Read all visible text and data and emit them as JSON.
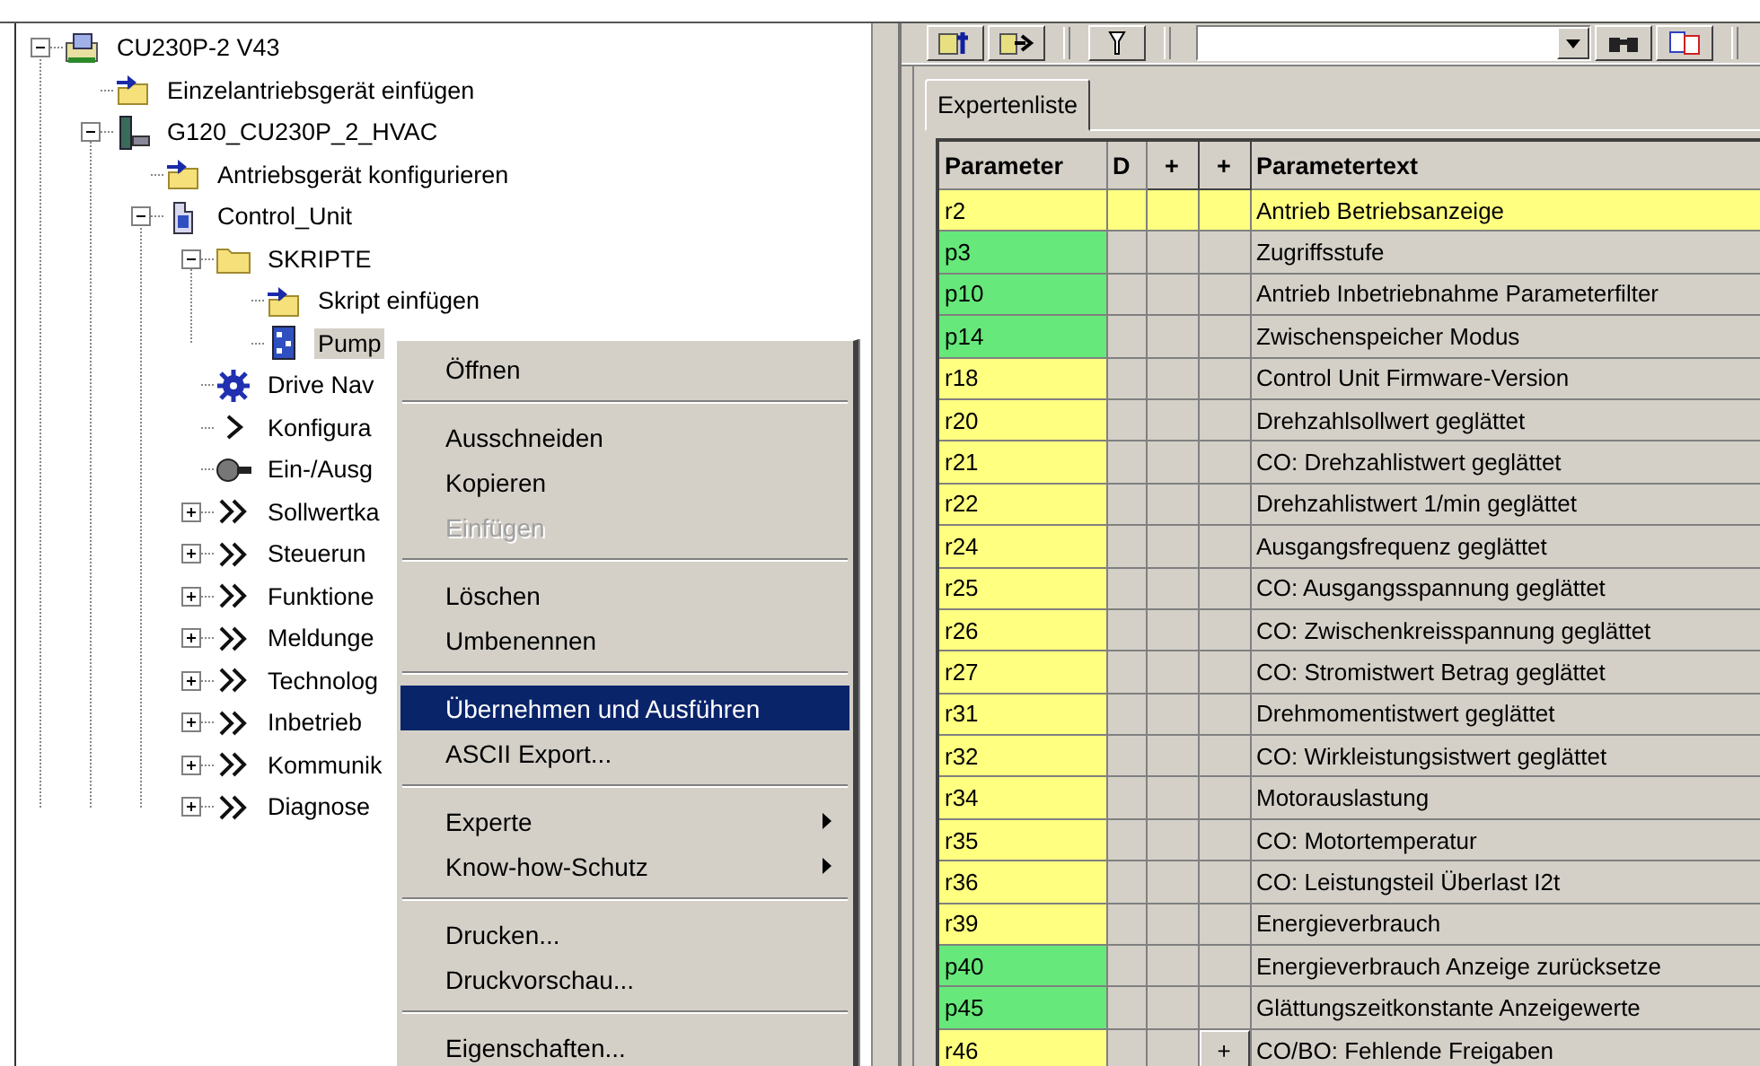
{
  "tree": [
    {
      "label": "CU230P-2 V43",
      "kind": "project",
      "expanded": true,
      "selected": false,
      "children": [
        {
          "label": "Einzelantriebsgerät einfügen",
          "kind": "insert",
          "selected": false
        },
        {
          "label": "G120_CU230P_2_HVAC",
          "kind": "device",
          "expanded": true,
          "selected": false,
          "children": [
            {
              "label": "Antriebsgerät konfigurieren",
              "kind": "insert",
              "selected": false
            },
            {
              "label": "Control_Unit",
              "kind": "unit",
              "expanded": true,
              "selected": false,
              "children": [
                {
                  "label": "SKRIPTE",
                  "kind": "folder",
                  "expanded": true,
                  "selected": false,
                  "children": [
                    {
                      "label": "Skript einfügen",
                      "kind": "insert",
                      "selected": false
                    },
                    {
                      "label": "Pump",
                      "kind": "script",
                      "selected": true
                    }
                  ]
                },
                {
                  "label": "Drive Nav",
                  "kind": "navigator",
                  "selected": false
                },
                {
                  "label": "Konfigura",
                  "kind": "wizard",
                  "selected": false
                },
                {
                  "label": "Ein-/Ausg",
                  "kind": "io",
                  "selected": false
                },
                {
                  "label": "Sollwertka",
                  "kind": "group",
                  "expanded": false,
                  "selected": false
                },
                {
                  "label": "Steuerun",
                  "kind": "group",
                  "expanded": false,
                  "selected": false
                },
                {
                  "label": "Funktione",
                  "kind": "group",
                  "expanded": false,
                  "selected": false
                },
                {
                  "label": "Meldunge",
                  "kind": "group",
                  "expanded": false,
                  "selected": false
                },
                {
                  "label": "Technolog",
                  "kind": "group",
                  "expanded": false,
                  "selected": false
                },
                {
                  "label": "Inbetrieb",
                  "kind": "group",
                  "expanded": false,
                  "selected": false
                },
                {
                  "label": "Kommunik",
                  "kind": "group",
                  "expanded": false,
                  "selected": false
                },
                {
                  "label": "Diagnose",
                  "kind": "group",
                  "expanded": false,
                  "selected": false
                }
              ]
            }
          ]
        }
      ]
    }
  ],
  "context_menu": [
    {
      "kind": "item",
      "label": "Öffnen",
      "disabled": false,
      "selected": false,
      "submenu": false
    },
    {
      "kind": "separator"
    },
    {
      "kind": "item",
      "label": "Ausschneiden",
      "disabled": false,
      "selected": false,
      "submenu": false
    },
    {
      "kind": "item",
      "label": "Kopieren",
      "disabled": false,
      "selected": false,
      "submenu": false
    },
    {
      "kind": "item",
      "label": "Einfügen",
      "disabled": true,
      "selected": false,
      "submenu": false
    },
    {
      "kind": "separator"
    },
    {
      "kind": "item",
      "label": "Löschen",
      "disabled": false,
      "selected": false,
      "submenu": false
    },
    {
      "kind": "item",
      "label": "Umbenennen",
      "disabled": false,
      "selected": false,
      "submenu": false
    },
    {
      "kind": "separator"
    },
    {
      "kind": "item",
      "label": "Übernehmen und Ausführen",
      "disabled": false,
      "selected": true,
      "submenu": false
    },
    {
      "kind": "item",
      "label": "ASCII Export...",
      "disabled": false,
      "selected": false,
      "submenu": false
    },
    {
      "kind": "separator"
    },
    {
      "kind": "item",
      "label": "Experte",
      "disabled": false,
      "selected": false,
      "submenu": true
    },
    {
      "kind": "item",
      "label": "Know-how-Schutz",
      "disabled": false,
      "selected": false,
      "submenu": true
    },
    {
      "kind": "separator"
    },
    {
      "kind": "item",
      "label": "Drucken...",
      "disabled": false,
      "selected": false,
      "submenu": false
    },
    {
      "kind": "item",
      "label": "Druckvorschau...",
      "disabled": false,
      "selected": false,
      "submenu": false
    },
    {
      "kind": "separator"
    },
    {
      "kind": "item",
      "label": "Eigenschaften...",
      "disabled": false,
      "selected": false,
      "submenu": false
    }
  ],
  "tabs": [
    {
      "label": "Expertenliste",
      "selected": true
    }
  ],
  "table": {
    "columns": [
      {
        "label": "Parameter",
        "kind": "text"
      },
      {
        "label": "D",
        "kind": "text"
      },
      {
        "label": "+",
        "kind": "button"
      },
      {
        "label": "+",
        "kind": "button"
      },
      {
        "label": "Parametertext",
        "kind": "text"
      }
    ],
    "rows": [
      {
        "parameter": "r2",
        "kind": "display",
        "selected": true,
        "text": "Antrieb Betriebsanzeige"
      },
      {
        "parameter": "p3",
        "kind": "adjustable",
        "selected": false,
        "text": "Zugriffsstufe"
      },
      {
        "parameter": "p10",
        "kind": "adjustable",
        "selected": false,
        "text": "Antrieb Inbetriebnahme Parameterfilter"
      },
      {
        "parameter": "p14",
        "kind": "adjustable",
        "selected": false,
        "text": "Zwischenspeicher Modus"
      },
      {
        "parameter": "r18",
        "kind": "display",
        "selected": false,
        "text": "Control Unit Firmware-Version"
      },
      {
        "parameter": "r20",
        "kind": "display",
        "selected": false,
        "text": "Drehzahlsollwert geglättet"
      },
      {
        "parameter": "r21",
        "kind": "display",
        "selected": false,
        "text": "CO: Drehzahlistwert geglättet"
      },
      {
        "parameter": "r22",
        "kind": "display",
        "selected": false,
        "text": "Drehzahlistwert 1/min geglättet"
      },
      {
        "parameter": "r24",
        "kind": "display",
        "selected": false,
        "text": "Ausgangsfrequenz geglättet"
      },
      {
        "parameter": "r25",
        "kind": "display",
        "selected": false,
        "text": "CO: Ausgangsspannung geglättet"
      },
      {
        "parameter": "r26",
        "kind": "display",
        "selected": false,
        "text": "CO: Zwischenkreisspannung geglättet"
      },
      {
        "parameter": "r27",
        "kind": "display",
        "selected": false,
        "text": "CO: Stromistwert Betrag geglättet"
      },
      {
        "parameter": "r31",
        "kind": "display",
        "selected": false,
        "text": "Drehmomentistwert geglättet"
      },
      {
        "parameter": "r32",
        "kind": "display",
        "selected": false,
        "text": "CO: Wirkleistungsistwert geglättet"
      },
      {
        "parameter": "r34",
        "kind": "display",
        "selected": false,
        "text": "Motorauslastung"
      },
      {
        "parameter": "r35",
        "kind": "display",
        "selected": false,
        "text": "CO: Motortemperatur"
      },
      {
        "parameter": "r36",
        "kind": "display",
        "selected": false,
        "text": "CO: Leistungsteil Überlast I2t"
      },
      {
        "parameter": "r39",
        "kind": "display",
        "selected": false,
        "text": "Energieverbrauch"
      },
      {
        "parameter": "p40",
        "kind": "adjustable",
        "selected": false,
        "text": "Energieverbrauch Anzeige zurücksetze"
      },
      {
        "parameter": "p45",
        "kind": "adjustable",
        "selected": false,
        "text": "Glättungszeitkonstante Anzeigewerte"
      },
      {
        "parameter": "r46",
        "kind": "display",
        "selected": false,
        "expand": "+",
        "text": "CO/BO: Fehlende Freigaben"
      }
    ]
  }
}
